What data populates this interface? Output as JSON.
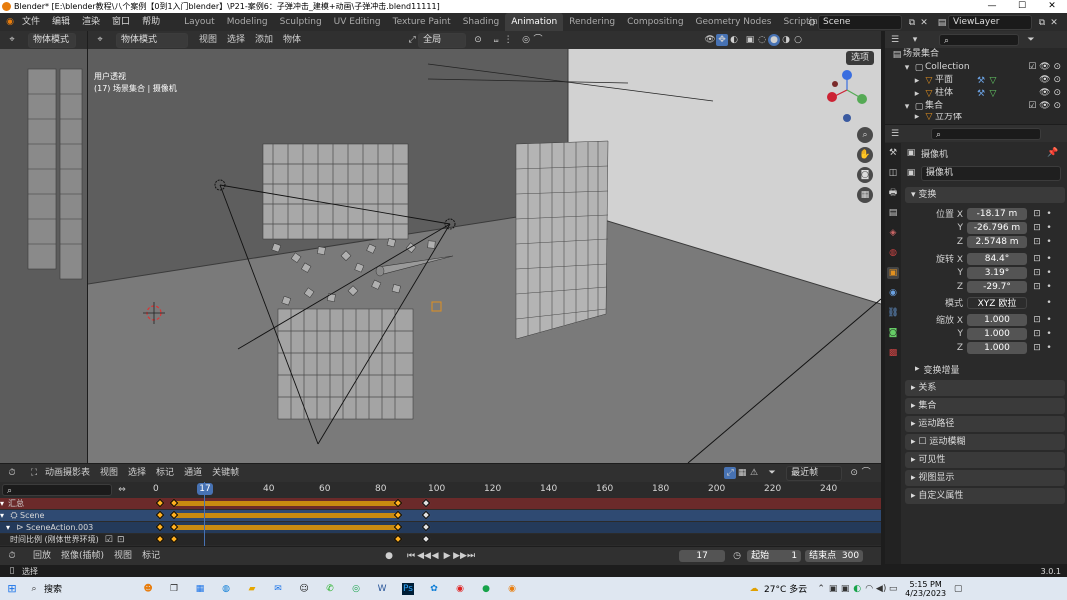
{
  "window": {
    "title": "Blender* [E:\\blender教程\\八个案例【0到1入门blender】\\P21-案例6：子弹冲击_建模+动画\\子弹冲击.blend11111]",
    "minimize": "—",
    "maximize": "☐",
    "close": "✕"
  },
  "menubar": {
    "items": [
      "文件",
      "编辑",
      "渲染",
      "窗口",
      "帮助"
    ],
    "workspaces": [
      "Layout",
      "Modeling",
      "Sculpting",
      "UV Editing",
      "Texture Paint",
      "Shading",
      "Animation",
      "Rendering",
      "Compositing",
      "Geometry Nodes",
      "Scripting"
    ],
    "active_workspace": "Animation",
    "add_tab": "+",
    "scene": "Scene",
    "view_layer": "ViewLayer"
  },
  "viewport_header": {
    "mode_left": "物体模式",
    "mode": "物体模式",
    "menus": [
      "视图",
      "选择",
      "添加",
      "物体"
    ],
    "orientation": "全局",
    "options": "选项"
  },
  "viewport": {
    "view_name": "用户透视",
    "collection_info": "(17) 场景集合 | 摄像机"
  },
  "outliner": {
    "root": "场景集合",
    "rows": [
      {
        "label": "Collection",
        "indent": 1
      },
      {
        "label": "平面",
        "indent": 2
      },
      {
        "label": "柱体",
        "indent": 2
      },
      {
        "label": "集合",
        "indent": 1
      },
      {
        "label": "立方体",
        "indent": 2
      }
    ]
  },
  "properties": {
    "object_name": "摄像机",
    "data_name": "摄像机",
    "section_transform": "变换",
    "location_label": "位置 X",
    "location": [
      "-18.17 m",
      "-26.796 m",
      "2.5748 m"
    ],
    "rotation_label": "旋转 X",
    "rotation": [
      "84.4°",
      "3.19°",
      "-29.7°"
    ],
    "axis_labels": [
      "Y",
      "Z"
    ],
    "mode_label": "模式",
    "rotation_mode": "XYZ 欧拉",
    "scale_label": "缩放 X",
    "scale": [
      "1.000",
      "1.000",
      "1.000"
    ],
    "delta_transform": "变换增量",
    "collapsed_sections": [
      "关系",
      "集合",
      "运动路径",
      "运动模糊",
      "可见性",
      "视图显示",
      "自定义属性"
    ]
  },
  "dopesheet": {
    "editor_mode": "动画摄影表",
    "menus": [
      "视图",
      "选择",
      "标记",
      "通道",
      "关键帧"
    ],
    "interpolation": "最近帧",
    "current_frame": "17",
    "ruler": [
      "0",
      "20",
      "40",
      "60",
      "80",
      "100",
      "120",
      "140",
      "160",
      "180",
      "200",
      "220",
      "240"
    ],
    "channels": [
      "汇总",
      "Scene",
      "SceneAction.003",
      "时间比例 (刚体世界环境)"
    ],
    "keyframes": [
      {
        "row": 0,
        "frames": [
          2,
          7,
          87,
          97
        ]
      },
      {
        "row": 1,
        "frames": [
          2,
          7,
          87,
          97
        ]
      },
      {
        "row": 2,
        "frames": [
          2,
          7,
          87,
          97
        ]
      },
      {
        "row": 3,
        "frames": [
          2,
          7,
          87,
          97
        ]
      }
    ],
    "action_bars": [
      {
        "row": 0,
        "start": 7,
        "end": 87
      },
      {
        "row": 1,
        "start": 7,
        "end": 87
      },
      {
        "row": 2,
        "start": 7,
        "end": 87
      }
    ]
  },
  "timeline": {
    "playback": "回放",
    "keying": "抠像(插帧)",
    "menus": [
      "视图",
      "标记"
    ],
    "frame": "17",
    "start_label": "起始",
    "start": "1",
    "end_label": "结束点",
    "end": "300"
  },
  "statusbar": {
    "left": "选择",
    "version": "3.0.1"
  },
  "taskbar": {
    "search": "搜索",
    "weather": "27°C 多云",
    "time": "5:15 PM",
    "date": "4/23/2023"
  },
  "colors": {
    "accent_blue": "#4772b3",
    "keyframe_orange": "#ffb020",
    "summary_row": "#6b2a2a",
    "scene_row": "#2f4a72"
  }
}
